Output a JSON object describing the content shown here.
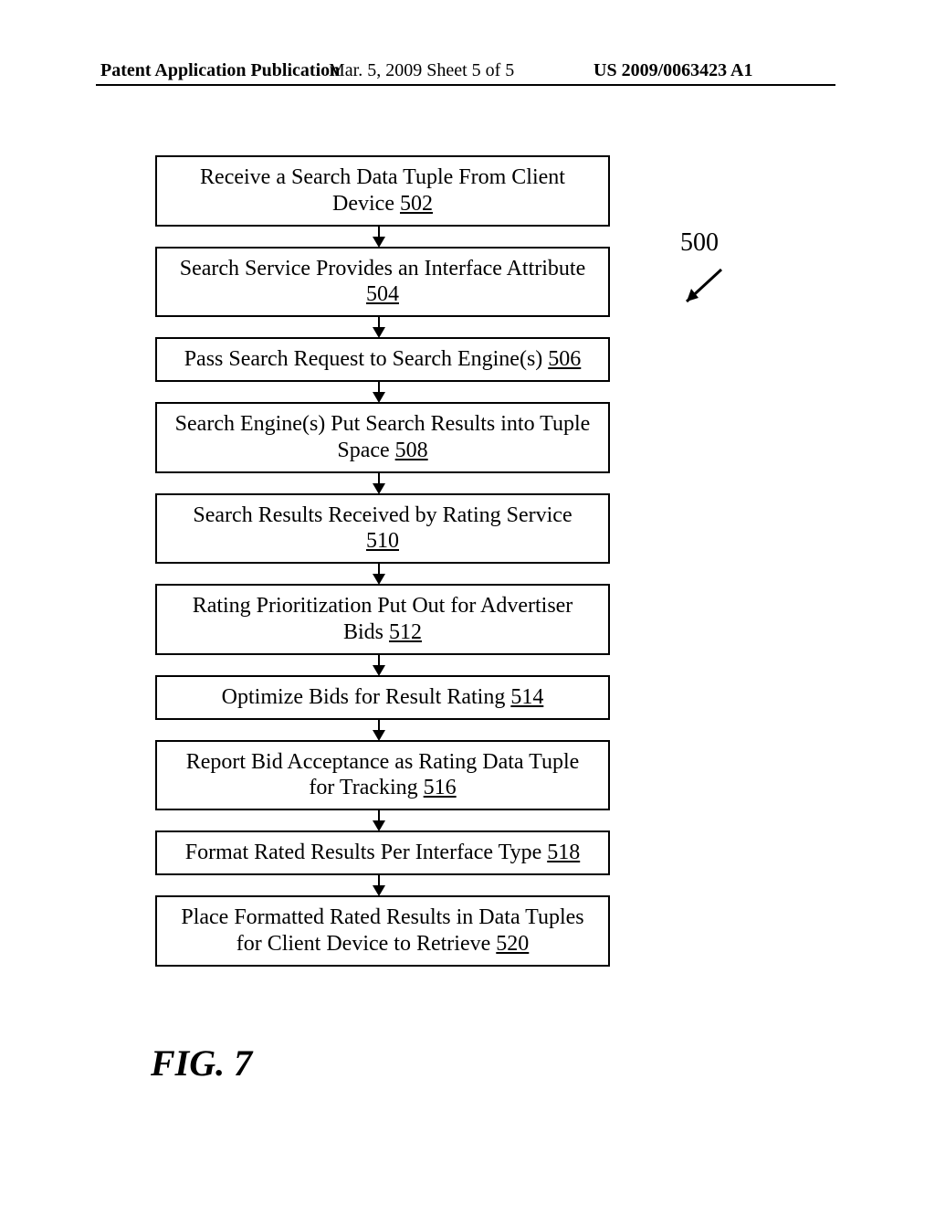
{
  "header": {
    "left": "Patent Application Publication",
    "mid": "Mar. 5, 2009  Sheet 5 of 5",
    "right": "US 2009/0063423 A1"
  },
  "side_label": "500",
  "figure_label": "FIG. 7",
  "steps": [
    {
      "text": "Receive a Search Data Tuple From Client\nDevice ",
      "ref": "502"
    },
    {
      "text": "Search Service Provides an Interface Attribute\n",
      "ref": "504"
    },
    {
      "text": "Pass Search Request to Search Engine(s)   ",
      "ref": "506"
    },
    {
      "text": "Search Engine(s) Put Search Results into Tuple\nSpace ",
      "ref": "508"
    },
    {
      "text": "Search Results Received by Rating Service\n",
      "ref": "510"
    },
    {
      "text": "Rating Prioritization Put Out for Advertiser\nBids   ",
      "ref": "512"
    },
    {
      "text": "Optimize Bids for Result Rating   ",
      "ref": "514"
    },
    {
      "text": "Report Bid Acceptance as Rating Data Tuple\nfor Tracking   ",
      "ref": "516"
    },
    {
      "text": "Format Rated Results Per Interface Type   ",
      "ref": "518"
    },
    {
      "text": "Place Formatted Rated Results in Data Tuples\nfor Client Device to Retrieve   ",
      "ref": "520"
    }
  ]
}
